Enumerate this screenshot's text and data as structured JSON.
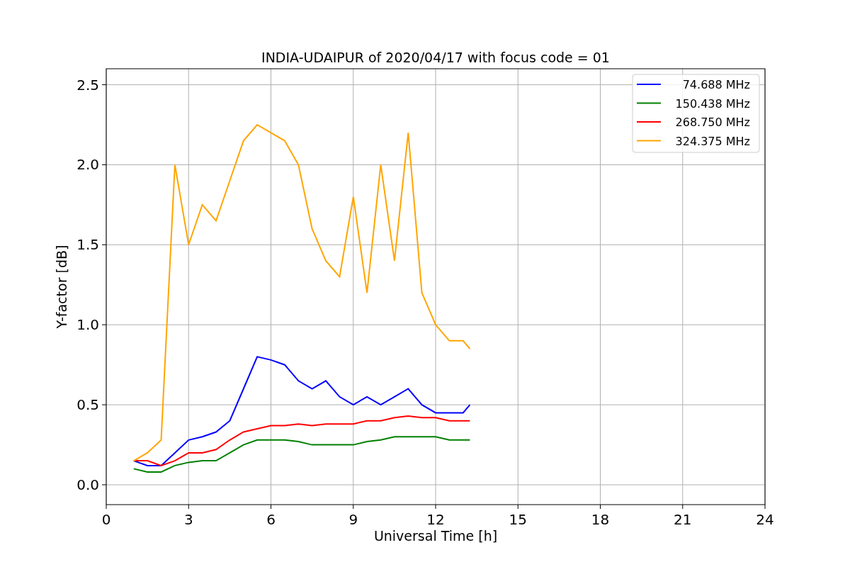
{
  "chart_data": {
    "type": "line",
    "title": "INDIA-UDAIPUR of 2020/04/17 with focus code = 01",
    "xlabel": "Universal Time [h]",
    "ylabel": "Y-factor [dB]",
    "x": [
      1,
      1.5,
      2,
      2.5,
      3,
      3.5,
      4,
      4.5,
      5,
      5.5,
      6,
      6.5,
      7,
      7.5,
      8,
      8.5,
      9,
      9.5,
      10,
      10.5,
      11,
      11.5,
      12,
      12.5,
      13,
      13.25
    ],
    "series": [
      {
        "name": "74.688 MHz",
        "color": "#0000ff",
        "values": [
          0.15,
          0.12,
          0.12,
          0.2,
          0.28,
          0.3,
          0.33,
          0.4,
          0.6,
          0.8,
          0.78,
          0.75,
          0.65,
          0.6,
          0.65,
          0.55,
          0.5,
          0.55,
          0.5,
          0.55,
          0.6,
          0.5,
          0.45,
          0.45,
          0.45,
          0.5
        ]
      },
      {
        "name": "150.438 MHz",
        "color": "#008000",
        "values": [
          0.1,
          0.08,
          0.08,
          0.12,
          0.14,
          0.15,
          0.15,
          0.2,
          0.25,
          0.28,
          0.28,
          0.28,
          0.27,
          0.25,
          0.25,
          0.25,
          0.25,
          0.27,
          0.28,
          0.3,
          0.3,
          0.3,
          0.3,
          0.28,
          0.28,
          0.28
        ]
      },
      {
        "name": "268.750 MHz",
        "color": "#ff0000",
        "values": [
          0.15,
          0.15,
          0.12,
          0.15,
          0.2,
          0.2,
          0.22,
          0.28,
          0.33,
          0.35,
          0.37,
          0.37,
          0.38,
          0.37,
          0.38,
          0.38,
          0.38,
          0.4,
          0.4,
          0.42,
          0.43,
          0.42,
          0.42,
          0.4,
          0.4,
          0.4
        ]
      },
      {
        "name": "324.375 MHz",
        "color": "#ffa500",
        "values": [
          0.15,
          0.2,
          0.28,
          2.0,
          1.5,
          1.75,
          1.65,
          1.9,
          2.15,
          2.25,
          2.2,
          2.15,
          2.0,
          1.6,
          1.4,
          1.3,
          1.8,
          1.2,
          2.0,
          1.4,
          2.2,
          1.2,
          1.0,
          0.9,
          0.9,
          0.85
        ]
      }
    ],
    "grid": true,
    "legend": true,
    "xlim": [
      0,
      24
    ],
    "ylim": [
      -0.124,
      2.6
    ],
    "xticks": [
      0,
      3,
      6,
      9,
      12,
      15,
      18,
      21,
      24
    ],
    "yticks": [
      {
        "value": 0,
        "label": "0.0"
      },
      {
        "value": 0.5,
        "label": "0.5"
      },
      {
        "value": 1,
        "label": "1.0"
      },
      {
        "value": 1.5,
        "label": "1.5"
      },
      {
        "value": 2,
        "label": "2.0"
      },
      {
        "value": 2.5,
        "label": "2.5"
      }
    ]
  }
}
